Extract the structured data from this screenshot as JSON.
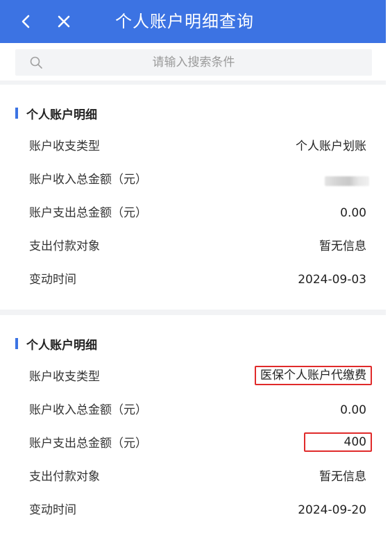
{
  "header": {
    "title": "个人账户明细查询",
    "back_icon": "chevron-left-icon",
    "close_icon": "close-icon"
  },
  "search": {
    "placeholder": "请输入搜索条件",
    "icon": "search-icon"
  },
  "records": [
    {
      "section_title": "个人账户明细",
      "rows": [
        {
          "label": "账户收支类型",
          "value": "个人账户划账"
        },
        {
          "label": "账户收入总金额（元）",
          "value": "",
          "blurred": true
        },
        {
          "label": "账户支出总金额（元）",
          "value": "0.00"
        },
        {
          "label": "支出付款对象",
          "value": "暂无信息"
        },
        {
          "label": "变动时间",
          "value": "2024-09-03"
        }
      ]
    },
    {
      "section_title": "个人账户明细",
      "rows": [
        {
          "label": "账户收支类型",
          "value": "医保个人账户代缴费",
          "highlighted": true
        },
        {
          "label": "账户收入总金额（元）",
          "value": "0.00"
        },
        {
          "label": "账户支出总金额（元）",
          "value": "400",
          "highlighted": true
        },
        {
          "label": "支出付款对象",
          "value": "暂无信息"
        },
        {
          "label": "变动时间",
          "value": "2024-09-20"
        }
      ]
    }
  ],
  "colors": {
    "header_bg": "#3c73e3",
    "accent": "#3c73e3",
    "highlight_border": "#e02a2a",
    "divider_bg": "#f2f3f5"
  }
}
